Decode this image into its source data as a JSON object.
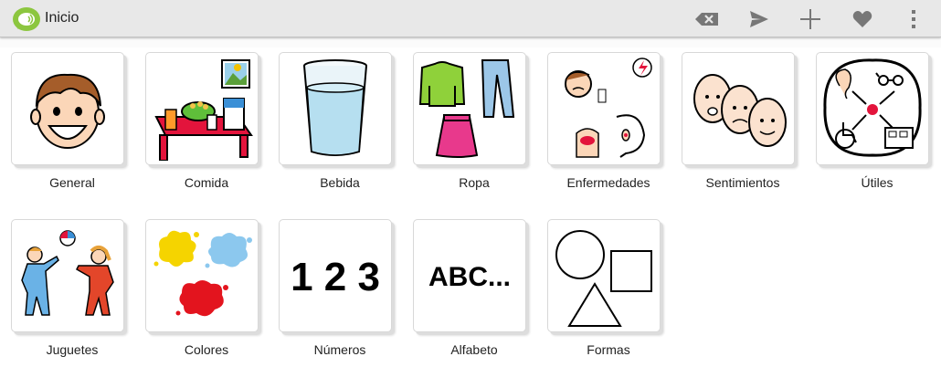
{
  "appbar": {
    "title": "Inicio",
    "actions": [
      {
        "name": "backspace-icon"
      },
      {
        "name": "send-icon"
      },
      {
        "name": "plus-icon"
      },
      {
        "name": "heart-icon"
      },
      {
        "name": "more-vert-icon"
      }
    ]
  },
  "categories": [
    {
      "label": "General",
      "icon": "smiling-face-icon"
    },
    {
      "label": "Comida",
      "icon": "food-table-icon"
    },
    {
      "label": "Bebida",
      "icon": "water-glass-icon"
    },
    {
      "label": "Ropa",
      "icon": "clothes-icon"
    },
    {
      "label": "Enfermedades",
      "icon": "illness-icon"
    },
    {
      "label": "Sentimientos",
      "icon": "feelings-faces-icon"
    },
    {
      "label": "Útiles",
      "icon": "utilities-icon"
    },
    {
      "label": "Juguetes",
      "icon": "children-playing-ball-icon"
    },
    {
      "label": "Colores",
      "icon": "paint-splashes-icon"
    },
    {
      "label": "Números",
      "icon": "numbers-icon",
      "text": "1 2 3"
    },
    {
      "label": "Alfabeto",
      "icon": "alphabet-icon",
      "text": "ABC..."
    },
    {
      "label": "Formas",
      "icon": "shapes-icon"
    }
  ],
  "colors": {
    "appbar_bg": "#e8e8e8",
    "logo_green": "#8cc63f",
    "icon_gray": "#777777"
  }
}
